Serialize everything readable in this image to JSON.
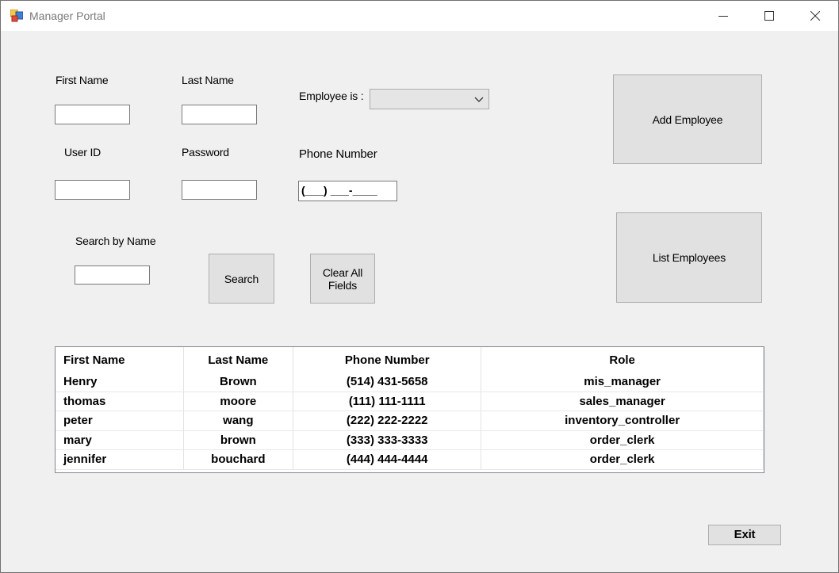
{
  "window": {
    "title": "Manager Portal"
  },
  "form": {
    "first_name_label": "First Name",
    "last_name_label": "Last Name",
    "employee_is_label": "Employee is :",
    "employee_is_value": "",
    "user_id_label": "User ID",
    "password_label": "Password",
    "phone_number_label": "Phone Number",
    "phone_mask": "(___) ___-____",
    "search_by_name_label": "Search by Name"
  },
  "buttons": {
    "add_employee": "Add Employee",
    "list_employees": "List Employees",
    "search": "Search",
    "clear_all_line1": "Clear All",
    "clear_all_line2": "Fields",
    "exit": "Exit"
  },
  "table": {
    "columns": [
      "First Name",
      "Last Name",
      "Phone Number",
      "Role"
    ],
    "rows": [
      [
        "Henry",
        "Brown",
        "(514) 431-5658",
        "mis_manager"
      ],
      [
        "thomas",
        "moore",
        "(111) 111-1111",
        "sales_manager"
      ],
      [
        "peter",
        "wang",
        "(222) 222-2222",
        "inventory_controller"
      ],
      [
        "mary",
        "brown",
        "(333) 333-3333",
        "order_clerk"
      ],
      [
        "jennifer",
        "bouchard",
        "(444) 444-4444",
        "order_clerk"
      ]
    ]
  }
}
